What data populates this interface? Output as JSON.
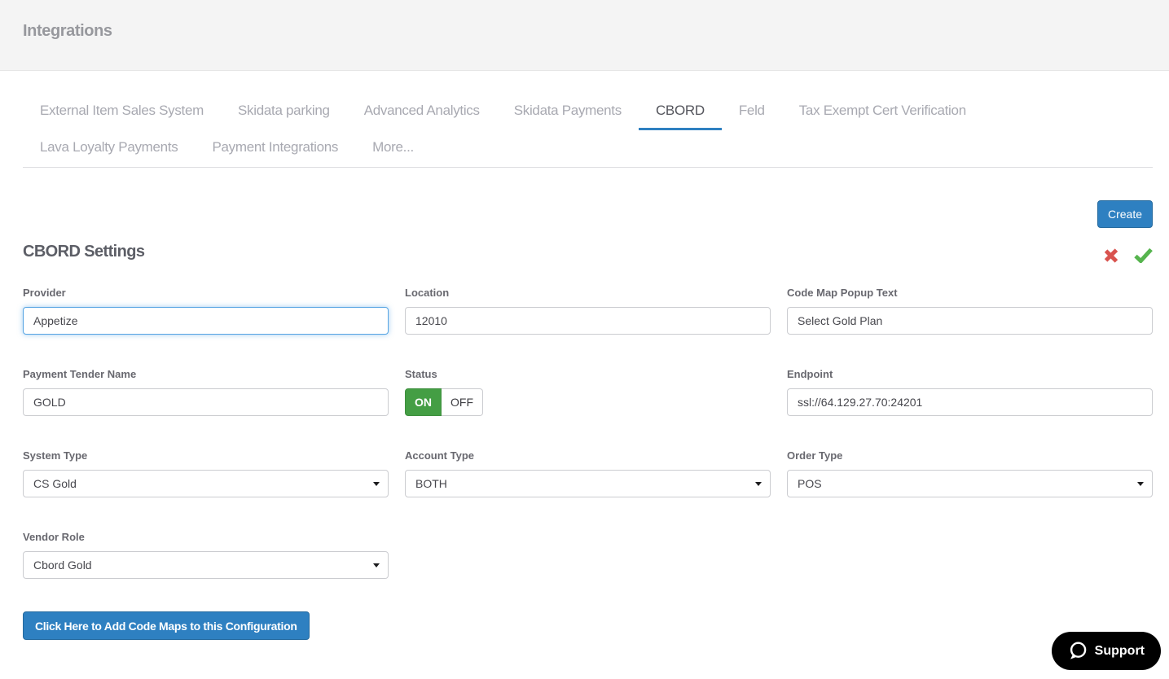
{
  "header": {
    "title": "Integrations"
  },
  "tabs": {
    "items": [
      {
        "label": "External Item Sales System",
        "active": false
      },
      {
        "label": "Skidata parking",
        "active": false
      },
      {
        "label": "Advanced Analytics",
        "active": false
      },
      {
        "label": "Skidata Payments",
        "active": false
      },
      {
        "label": "CBORD",
        "active": true
      },
      {
        "label": "Feld",
        "active": false
      },
      {
        "label": "Tax Exempt Cert Verification",
        "active": false
      },
      {
        "label": "Lava Loyalty Payments",
        "active": false
      },
      {
        "label": "Payment Integrations",
        "active": false
      },
      {
        "label": "More...",
        "active": false
      }
    ]
  },
  "toolbar": {
    "create_label": "Create"
  },
  "section": {
    "title": "CBORD Settings",
    "icons": {
      "cancel": "x-icon",
      "confirm": "check-icon"
    }
  },
  "form": {
    "provider": {
      "label": "Provider",
      "value": "Appetize",
      "focused": true
    },
    "location": {
      "label": "Location",
      "value": "12010"
    },
    "code_map_popup_text": {
      "label": "Code Map Popup Text",
      "value": "Select Gold Plan"
    },
    "payment_tender_name": {
      "label": "Payment Tender Name",
      "value": "GOLD"
    },
    "status": {
      "label": "Status",
      "on_label": "ON",
      "off_label": "OFF",
      "value": "ON"
    },
    "endpoint": {
      "label": "Endpoint",
      "value": "ssl://64.129.27.70:24201"
    },
    "system_type": {
      "label": "System Type",
      "value": "CS Gold"
    },
    "account_type": {
      "label": "Account Type",
      "value": "BOTH"
    },
    "order_type": {
      "label": "Order Type",
      "value": "POS"
    },
    "vendor_role": {
      "label": "Vendor Role",
      "value": "Cbord Gold"
    }
  },
  "actions": {
    "add_code_maps_label": "Click Here to Add Code Maps to this Configuration"
  },
  "support": {
    "label": "Support"
  },
  "colors": {
    "accent_blue": "#2e80c1",
    "toggle_on_green": "#449e44",
    "check_green": "#56b44e",
    "cancel_red": "#d9534f",
    "header_bg": "#f4f4f4",
    "launcher_bg": "#000000"
  }
}
